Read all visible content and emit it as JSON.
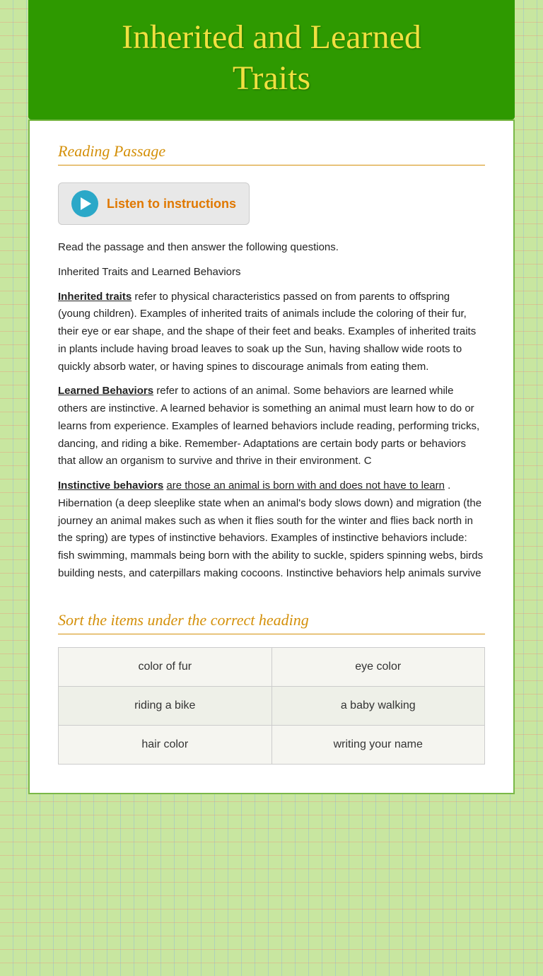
{
  "header": {
    "title_line1": "Inherited and Learned",
    "title_line2": "Traits"
  },
  "reading_section": {
    "label": "Reading Passage",
    "listen_button": "Listen to instructions",
    "intro_line1": "Read the passage and then answer the following questions.",
    "intro_line2": "Inherited Traits and Learned Behaviors",
    "paragraph1": "refer to physical characteristics passed on from parents to offspring (young children). Examples of inherited traits of animals include the coloring of their fur, their eye or ear shape, and the shape of their feet and beaks. Examples of inherited traits in plants include having broad leaves to soak up the Sun, having shallow wide roots to quickly absorb water, or having spines to discourage animals from eating them.",
    "paragraph1_bold": "Inherited traits",
    "paragraph2_bold": "Learned Behaviors",
    "paragraph2": " refer to actions of an animal. Some behaviors are learned while others are instinctive. A learned behavior is something an animal must learn how to do or learns from experience. Examples of learned behaviors include reading, performing tricks, dancing, and riding a bike. Remember- Adaptations are certain body parts or behaviors that allow an organism to survive and thrive in their environment. C",
    "paragraph2_underlined": "A learned behavior is something an animal must learn how to do or learns from experience",
    "paragraph3_bold": "Instinctive behaviors",
    "paragraph3_underlined": "are those an animal is born with and does not have to learn",
    "paragraph3": ". Hibernation (a deep sleeplike state when an animal's body slows down) and migration (the journey an animal makes such as when it flies south for the winter and flies back north in the spring) are types of instinctive behaviors. Examples of instinctive behaviors include: fish swimming, mammals being born with the ability to suckle, spiders spinning webs, birds building nests, and caterpillars making cocoons. Instinctive behaviors help animals survive"
  },
  "sort_section": {
    "label": "Sort the items under the correct heading",
    "items": [
      {
        "left": "color of fur",
        "right": "eye color"
      },
      {
        "left": "riding a bike",
        "right": "a baby walking"
      },
      {
        "left": "hair color",
        "right": "writing your name"
      }
    ]
  }
}
